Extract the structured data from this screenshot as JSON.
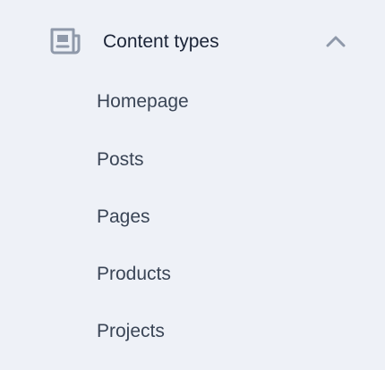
{
  "nav": {
    "group": {
      "title": "Content types",
      "icon": "newspaper-icon",
      "toggle_icon": "chevron-up-icon",
      "expanded": true,
      "items": [
        {
          "label": "Homepage"
        },
        {
          "label": "Posts"
        },
        {
          "label": "Pages"
        },
        {
          "label": "Products"
        },
        {
          "label": "Projects"
        }
      ]
    }
  },
  "colors": {
    "background": "#eef1f7",
    "title_text": "#1b2437",
    "item_text": "#3a4556",
    "icon": "#8f99aa"
  }
}
